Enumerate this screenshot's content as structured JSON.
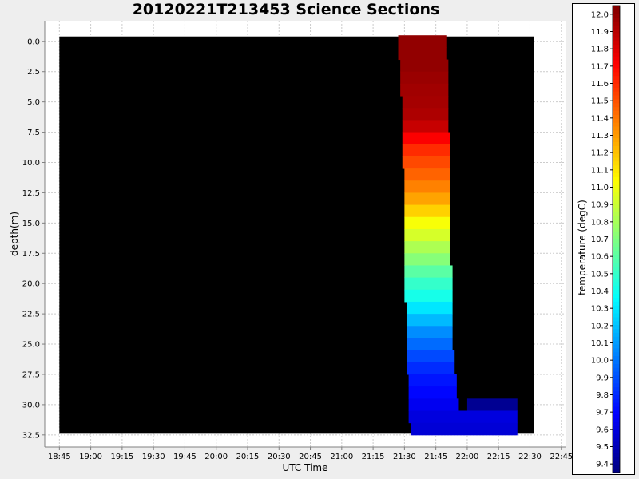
{
  "chart_data": {
    "type": "heatmap",
    "title": "20120221T213453 Science Sections",
    "xlabel": "UTC Time",
    "ylabel": "depth(m)",
    "colorbar_label": "temperature (degC)",
    "x_ticks": [
      "18:45",
      "19:00",
      "19:15",
      "19:30",
      "19:45",
      "20:00",
      "20:15",
      "20:30",
      "20:45",
      "21:00",
      "21:15",
      "21:30",
      "21:45",
      "22:00",
      "22:15",
      "22:30",
      "22:45"
    ],
    "y_ticks": [
      "0.0",
      "2.5",
      "5.0",
      "7.5",
      "10.0",
      "12.5",
      "15.0",
      "17.5",
      "20.0",
      "22.5",
      "25.0",
      "27.5",
      "30.0",
      "32.5"
    ],
    "colorbar_ticks": [
      "12.0",
      "11.9",
      "11.8",
      "11.7",
      "11.6",
      "11.5",
      "11.4",
      "11.3",
      "11.2",
      "11.1",
      "11.0",
      "10.9",
      "10.8",
      "10.7",
      "10.6",
      "10.5",
      "10.4",
      "10.3",
      "10.2",
      "10.1",
      "10.0",
      "9.9",
      "9.8",
      "9.7",
      "9.6",
      "9.5",
      "9.4"
    ],
    "xlim": [
      "18:38",
      "22:47"
    ],
    "ylim": [
      -1.7,
      33.5
    ],
    "grid": true,
    "colormap": "jet",
    "color_range": [
      9.35,
      12.05
    ],
    "background_color": "#000000",
    "cells": [
      {
        "depth": 0,
        "t_start": "21:27",
        "t_end": "21:50",
        "temp": 12.0
      },
      {
        "depth": 1,
        "t_start": "21:27",
        "t_end": "21:50",
        "temp": 12.0
      },
      {
        "depth": 2,
        "t_start": "21:28",
        "t_end": "21:51",
        "temp": 12.0
      },
      {
        "depth": 3,
        "t_start": "21:28",
        "t_end": "21:51",
        "temp": 11.98
      },
      {
        "depth": 4,
        "t_start": "21:28",
        "t_end": "21:51",
        "temp": 11.96
      },
      {
        "depth": 5,
        "t_start": "21:29",
        "t_end": "21:51",
        "temp": 11.95
      },
      {
        "depth": 6,
        "t_start": "21:29",
        "t_end": "21:51",
        "temp": 11.93
      },
      {
        "depth": 7,
        "t_start": "21:29",
        "t_end": "21:51",
        "temp": 11.86
      },
      {
        "depth": 8,
        "t_start": "21:29",
        "t_end": "21:52",
        "temp": 11.72
      },
      {
        "depth": 9,
        "t_start": "21:29",
        "t_end": "21:52",
        "temp": 11.6
      },
      {
        "depth": 10,
        "t_start": "21:29",
        "t_end": "21:52",
        "temp": 11.52
      },
      {
        "depth": 11,
        "t_start": "21:30",
        "t_end": "21:52",
        "temp": 11.45
      },
      {
        "depth": 12,
        "t_start": "21:30",
        "t_end": "21:52",
        "temp": 11.37
      },
      {
        "depth": 13,
        "t_start": "21:30",
        "t_end": "21:52",
        "temp": 11.28
      },
      {
        "depth": 14,
        "t_start": "21:30",
        "t_end": "21:52",
        "temp": 11.16
      },
      {
        "depth": 15,
        "t_start": "21:30",
        "t_end": "21:52",
        "temp": 11.02
      },
      {
        "depth": 16,
        "t_start": "21:30",
        "t_end": "21:52",
        "temp": 10.93
      },
      {
        "depth": 17,
        "t_start": "21:30",
        "t_end": "21:52",
        "temp": 10.82
      },
      {
        "depth": 18,
        "t_start": "21:30",
        "t_end": "21:52",
        "temp": 10.72
      },
      {
        "depth": 19,
        "t_start": "21:30",
        "t_end": "21:53",
        "temp": 10.6
      },
      {
        "depth": 20,
        "t_start": "21:30",
        "t_end": "21:53",
        "temp": 10.5
      },
      {
        "depth": 21,
        "t_start": "21:30",
        "t_end": "21:53",
        "temp": 10.42
      },
      {
        "depth": 22,
        "t_start": "21:31",
        "t_end": "21:53",
        "temp": 10.3
      },
      {
        "depth": 23,
        "t_start": "21:31",
        "t_end": "21:53",
        "temp": 10.18
      },
      {
        "depth": 24,
        "t_start": "21:31",
        "t_end": "21:53",
        "temp": 10.06
      },
      {
        "depth": 25,
        "t_start": "21:31",
        "t_end": "21:53",
        "temp": 9.97
      },
      {
        "depth": 26,
        "t_start": "21:31",
        "t_end": "21:54",
        "temp": 9.88
      },
      {
        "depth": 27,
        "t_start": "21:31",
        "t_end": "21:54",
        "temp": 9.8
      },
      {
        "depth": 28,
        "t_start": "21:32",
        "t_end": "21:55",
        "temp": 9.74
      },
      {
        "depth": 29,
        "t_start": "21:32",
        "t_end": "21:55",
        "temp": 9.7
      },
      {
        "depth": 30,
        "t_start": "21:32",
        "t_end": "21:56",
        "temp": 9.65
      },
      {
        "depth": 30,
        "t_start": "22:00",
        "t_end": "22:24",
        "temp": 9.4
      },
      {
        "depth": 31,
        "t_start": "21:32",
        "t_end": "22:24",
        "temp": 9.6
      },
      {
        "depth": 32,
        "t_start": "21:33",
        "t_end": "22:24",
        "temp": 9.58
      }
    ]
  }
}
